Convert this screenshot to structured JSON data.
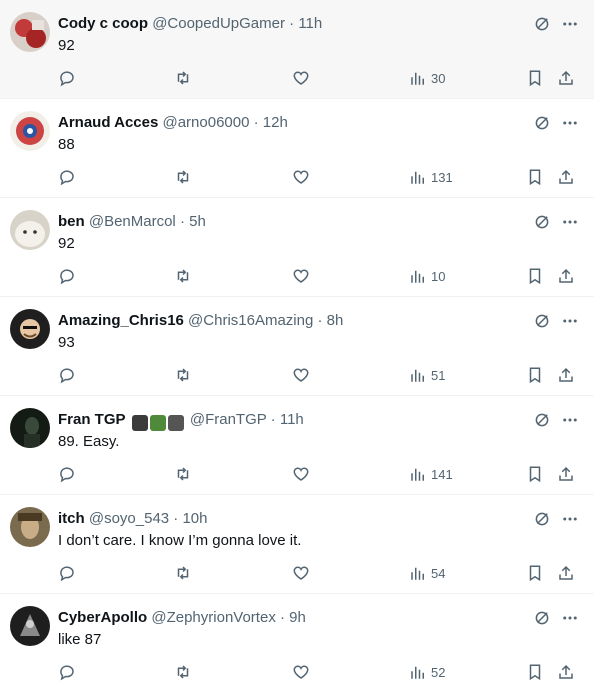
{
  "colors": {
    "text": "#0f1419",
    "muted": "#536471",
    "border": "#eff3f4",
    "hover_bg": "#f7f7f7"
  },
  "icons": {
    "reply": "reply-icon",
    "retweet": "retweet-icon",
    "like": "heart-icon",
    "views": "views-icon",
    "bookmark": "bookmark-icon",
    "share": "share-icon",
    "grok": "grok-icon",
    "more": "more-icon"
  },
  "tweets": [
    {
      "name": "Cody c coop",
      "handle": "@CoopedUpGamer",
      "dot": "·",
      "time": "11h",
      "text": "92",
      "views": "30",
      "emoji": ""
    },
    {
      "name": "Arnaud Acces",
      "handle": "@arno06000",
      "dot": "·",
      "time": "12h",
      "text": "88",
      "views": "131",
      "emoji": ""
    },
    {
      "name": "ben",
      "handle": "@BenMarcol",
      "dot": "·",
      "time": "5h",
      "text": "92",
      "views": "10",
      "emoji": ""
    },
    {
      "name": "Amazing_Chris16",
      "handle": "@Chris16Amazing",
      "dot": "·",
      "time": "8h",
      "text": "93",
      "views": "51",
      "emoji": ""
    },
    {
      "name": "Fran TGP",
      "handle": "@FranTGP",
      "dot": "·",
      "time": "11h",
      "text": "89. Easy.",
      "views": "141",
      "emoji": "🎮🎬📸"
    },
    {
      "name": "itch",
      "handle": "@soyo_543",
      "dot": "·",
      "time": "10h",
      "text": "I don’t care. I know I’m gonna love it.",
      "views": "54",
      "emoji": ""
    },
    {
      "name": "CyberApollo",
      "handle": "@ZephyrionVortex",
      "dot": "·",
      "time": "9h",
      "text": "like 87",
      "views": "52",
      "emoji": ""
    }
  ]
}
